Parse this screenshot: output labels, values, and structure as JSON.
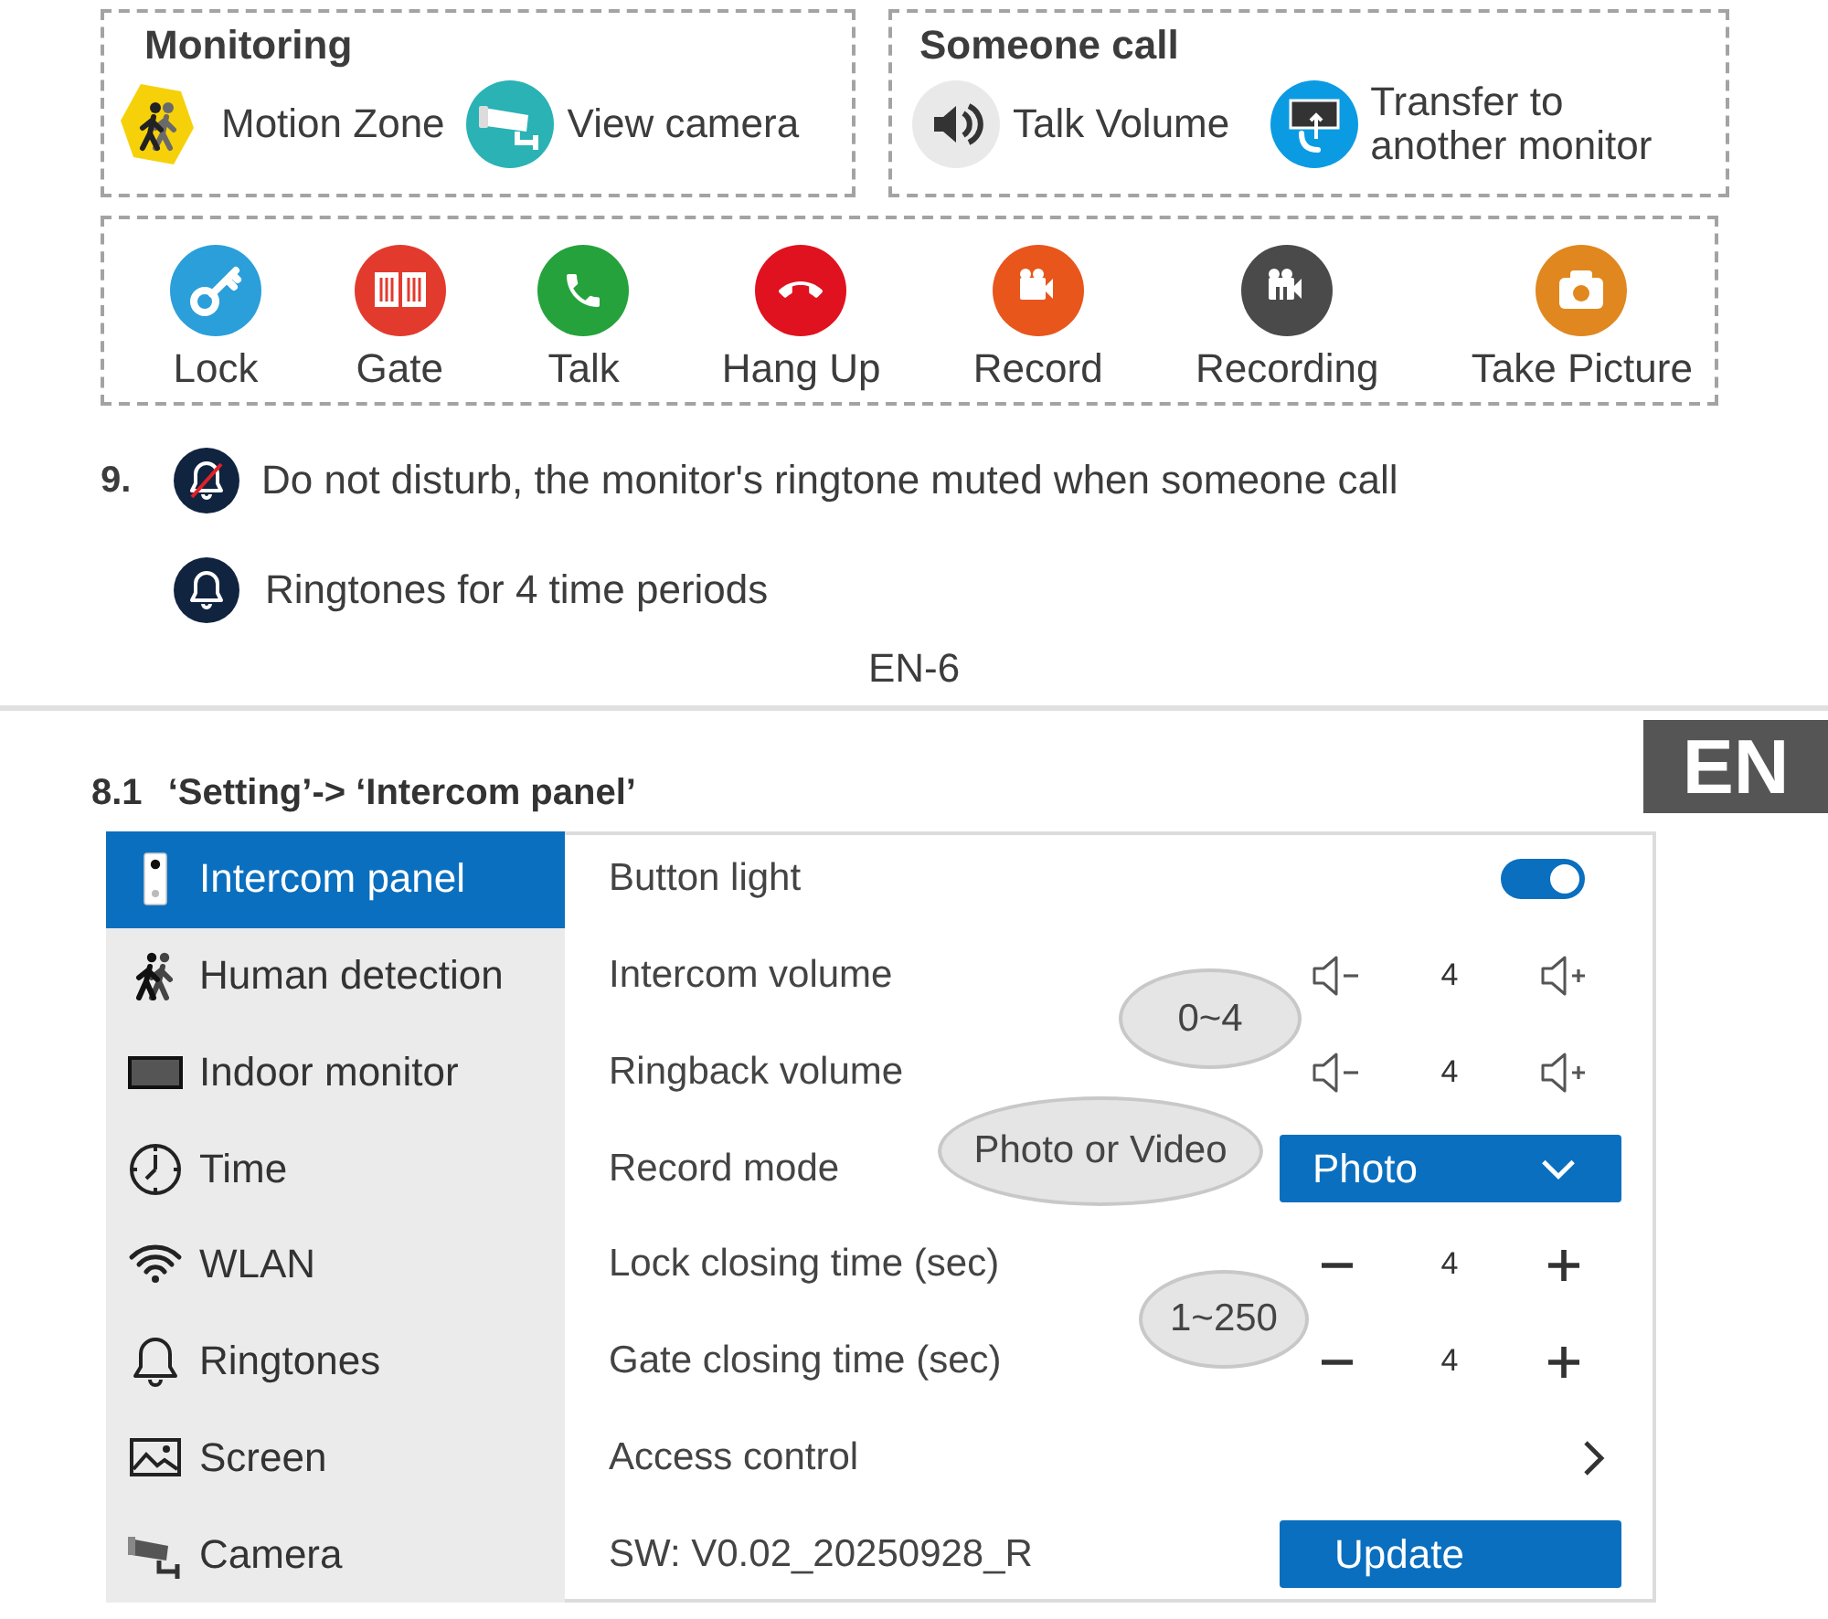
{
  "monitoring": {
    "title": "Monitoring",
    "items": [
      {
        "kind": "motion",
        "label": "Motion Zone"
      },
      {
        "kind": "cctv",
        "label": "View camera"
      }
    ]
  },
  "someone_call": {
    "title": "Someone call",
    "items": [
      {
        "kind": "speaker",
        "label": "Talk Volume"
      },
      {
        "kind": "transfer",
        "label": "Transfer to another monitor"
      }
    ]
  },
  "actions": [
    {
      "kind": "key",
      "label": "Lock",
      "color": "#2a9fda"
    },
    {
      "kind": "gate",
      "label": "Gate",
      "color": "#e23b2e"
    },
    {
      "kind": "phone",
      "label": "Talk",
      "color": "#25a23c"
    },
    {
      "kind": "hangup",
      "label": "Hang Up",
      "color": "#e0121f"
    },
    {
      "kind": "video",
      "label": "Record",
      "color": "#e8561c"
    },
    {
      "kind": "video_pause",
      "label": "Recording",
      "color": "#4a4a4a"
    },
    {
      "kind": "photo",
      "label": "Take Picture",
      "color": "#e0871f"
    }
  ],
  "notes": {
    "number": "9.",
    "items": [
      {
        "kind": "mute",
        "text": "Do not disturb, the monitor's ringtone muted when someone call"
      },
      {
        "kind": "bell",
        "text": "Ringtones for 4 time periods"
      }
    ]
  },
  "page_number": "EN-6",
  "language_tab": "EN",
  "section": {
    "number": "8.1",
    "title": "‘Setting’-> ‘Intercom panel’"
  },
  "settings": {
    "sidebar": [
      {
        "kind": "intercom",
        "label": "Intercom panel",
        "selected": true
      },
      {
        "kind": "human",
        "label": "Human detection",
        "selected": false
      },
      {
        "kind": "monitor",
        "label": "Indoor monitor",
        "selected": false
      },
      {
        "kind": "clock",
        "label": "Time",
        "selected": false
      },
      {
        "kind": "wifi",
        "label": "WLAN",
        "selected": false
      },
      {
        "kind": "bell",
        "label": "Ringtones",
        "selected": false
      },
      {
        "kind": "image",
        "label": "Screen",
        "selected": false
      },
      {
        "kind": "camera",
        "label": "Camera",
        "selected": false
      }
    ],
    "rows": [
      {
        "kind": "toggle",
        "label": "Button light",
        "on": true
      },
      {
        "kind": "volume",
        "label": "Intercom volume",
        "value": "4"
      },
      {
        "kind": "volume",
        "label": "Ringback volume",
        "value": "4"
      },
      {
        "kind": "dropdown",
        "label": "Record mode",
        "value": "Photo"
      },
      {
        "kind": "stepper",
        "label": "Lock closing time (sec)",
        "value": "4"
      },
      {
        "kind": "stepper",
        "label": "Gate closing time (sec)",
        "value": "4"
      },
      {
        "kind": "link",
        "label": "Access control"
      },
      {
        "kind": "update",
        "label": "SW: V0.02_20250928_R",
        "button": "Update"
      }
    ],
    "callouts": [
      "0~4",
      "Photo or Video",
      "1~250"
    ]
  }
}
